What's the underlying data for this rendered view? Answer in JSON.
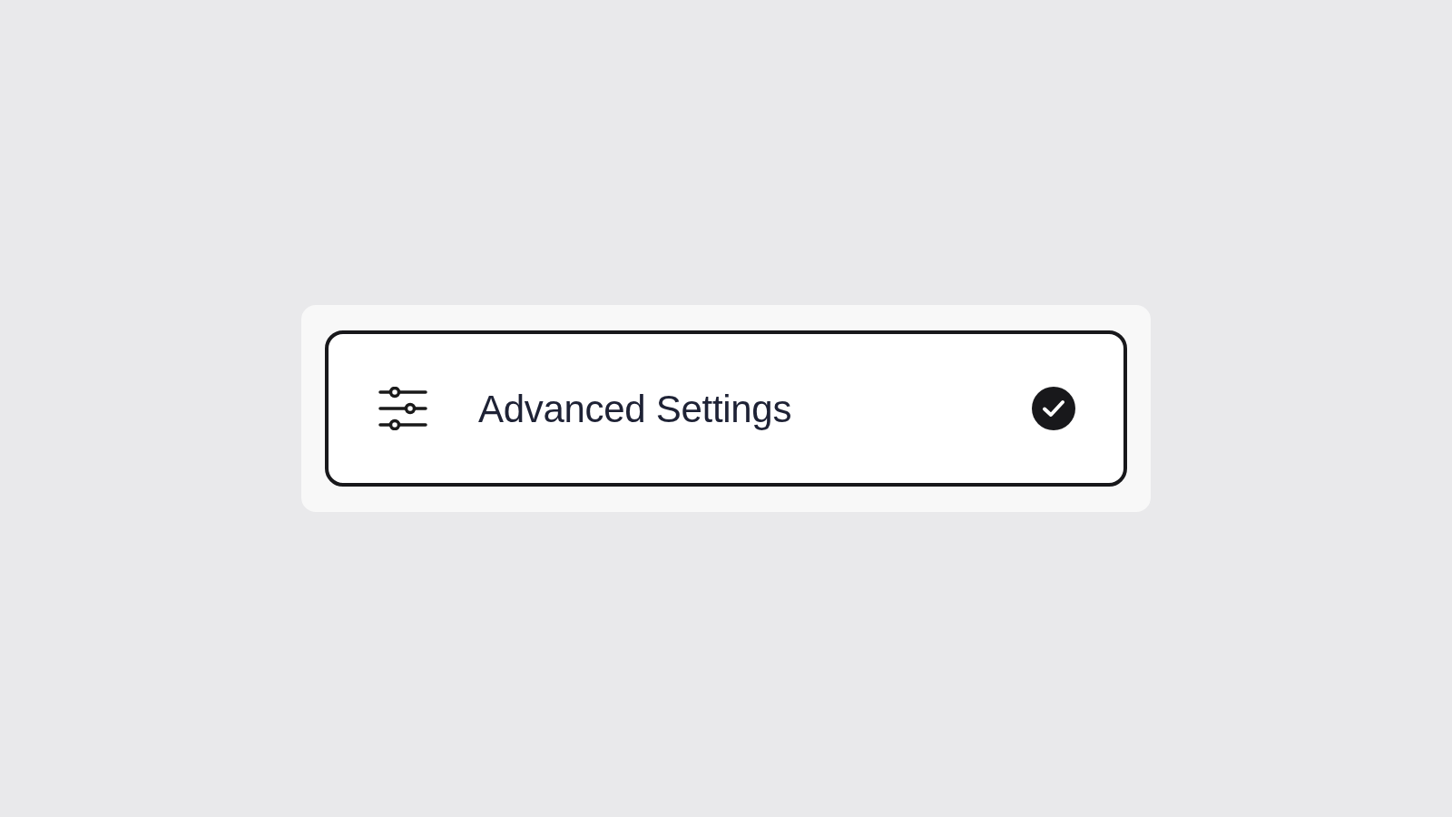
{
  "option": {
    "label": "Advanced Settings",
    "selected": true
  }
}
